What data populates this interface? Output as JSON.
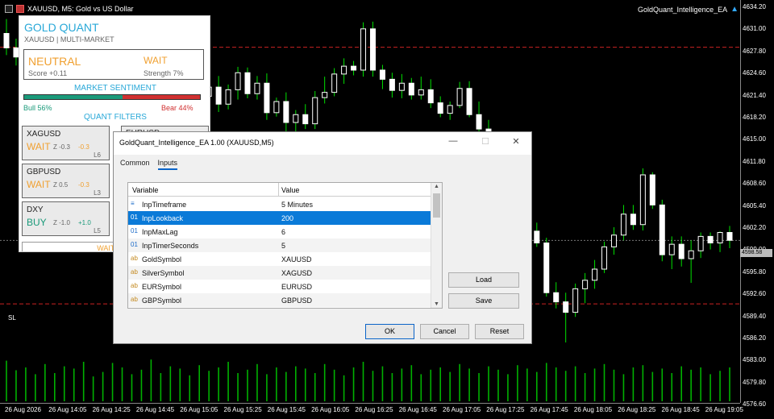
{
  "chart": {
    "title": "XAUUSD, M5:  Gold vs US Dollar",
    "ea_name": "GoldQuant_Intelligence_EA",
    "current_price": "4598.58",
    "sl_label": "SL",
    "price_labels": [
      "4634.20",
      "4631.00",
      "4627.80",
      "4624.60",
      "4621.40",
      "4618.20",
      "4615.00",
      "4611.80",
      "4608.60",
      "4605.40",
      "4602.20",
      "4599.00",
      "4595.80",
      "4592.60",
      "4589.40",
      "4586.20",
      "4583.00",
      "4579.80",
      "4576.60"
    ],
    "date_labels": [
      "26 Aug 2026",
      "26 Aug 14:05",
      "26 Aug 14:25",
      "26 Aug 14:45",
      "26 Aug 15:05",
      "26 Aug 15:25",
      "26 Aug 15:45",
      "26 Aug 16:05",
      "26 Aug 16:25",
      "26 Aug 16:45",
      "26 Aug 17:05",
      "26 Aug 17:25",
      "26 Aug 17:45",
      "26 Aug 18:05",
      "26 Aug 18:25",
      "26 Aug 18:45",
      "26 Aug 19:05"
    ],
    "colors": {
      "bull": "#ffffff",
      "wick": "#00e000",
      "volume": "#00b000",
      "level": "#cc2222",
      "background": "#000000"
    },
    "price_range": [
      4576.6,
      4634.2
    ],
    "level_prices": [
      4628.1,
      4598.58,
      4588.9
    ],
    "candles": [
      [
        4630.2,
        4632.4,
        4626.9,
        4628.0
      ],
      [
        4628.0,
        4629.4,
        4625.3,
        4626.6
      ],
      [
        4626.6,
        4628.2,
        4624.6,
        4627.2
      ],
      [
        4627.2,
        4629.0,
        4626.1,
        4626.5
      ],
      [
        4626.5,
        4627.8,
        4623.6,
        4625.0
      ],
      [
        4625.0,
        4627.6,
        4624.2,
        4626.4
      ],
      [
        4626.4,
        4630.4,
        4625.6,
        4628.6
      ],
      [
        4628.6,
        4629.6,
        4624.5,
        4625.4
      ],
      [
        4625.4,
        4628.6,
        4623.4,
        4627.0
      ],
      [
        4627.0,
        4630.8,
        4626.0,
        4629.9
      ],
      [
        4629.9,
        4631.3,
        4627.0,
        4628.6
      ],
      [
        4628.6,
        4630.2,
        4625.9,
        4627.3
      ],
      [
        4627.3,
        4629.5,
        4624.9,
        4626.4
      ],
      [
        4626.4,
        4627.2,
        4622.0,
        4623.2
      ],
      [
        4623.2,
        4625.9,
        4620.8,
        4624.6
      ],
      [
        4624.6,
        4626.8,
        4621.4,
        4622.1
      ],
      [
        4622.1,
        4623.5,
        4619.0,
        4620.4
      ],
      [
        4620.4,
        4624.0,
        4619.4,
        4623.2
      ],
      [
        4623.2,
        4625.3,
        4620.8,
        4621.5
      ],
      [
        4621.5,
        4622.8,
        4617.4,
        4618.6
      ],
      [
        4618.6,
        4621.8,
        4617.2,
        4620.6
      ],
      [
        4620.6,
        4623.5,
        4619.2,
        4622.0
      ],
      [
        4622.0,
        4623.7,
        4618.2,
        4619.4
      ],
      [
        4619.4,
        4622.4,
        4618.6,
        4621.6
      ],
      [
        4621.6,
        4625.1,
        4620.1,
        4624.2
      ],
      [
        4624.2,
        4625.0,
        4620.3,
        4621.0
      ],
      [
        4621.0,
        4623.7,
        4620.1,
        4622.6
      ],
      [
        4622.6,
        4624.1,
        4617.0,
        4618.1
      ],
      [
        4618.1,
        4620.4,
        4617.5,
        4619.8
      ],
      [
        4619.8,
        4621.2,
        4615.2,
        4616.6
      ],
      [
        4616.6,
        4618.5,
        4613.3,
        4617.8
      ],
      [
        4617.8,
        4619.4,
        4615.6,
        4616.4
      ],
      [
        4616.4,
        4621.4,
        4615.6,
        4620.4
      ],
      [
        4620.4,
        4623.6,
        4619.5,
        4621.2
      ],
      [
        4621.2,
        4624.9,
        4620.6,
        4624.0
      ],
      [
        4624.0,
        4626.4,
        4622.5,
        4625.2
      ],
      [
        4625.2,
        4626.0,
        4623.8,
        4624.6
      ],
      [
        4624.6,
        4631.9,
        4623.6,
        4630.9
      ],
      [
        4630.9,
        4632.0,
        4623.6,
        4624.6
      ],
      [
        4624.6,
        4625.4,
        4621.7,
        4623.2
      ],
      [
        4623.2,
        4624.2,
        4620.4,
        4621.5
      ],
      [
        4621.5,
        4624.0,
        4620.3,
        4622.6
      ],
      [
        4622.6,
        4623.4,
        4620.1,
        4620.8
      ],
      [
        4620.8,
        4623.6,
        4620.1,
        4621.6
      ],
      [
        4621.6,
        4623.2,
        4618.8,
        4619.6
      ],
      [
        4619.6,
        4620.6,
        4617.4,
        4618.0
      ],
      [
        4618.0,
        4619.8,
        4617.0,
        4619.2
      ],
      [
        4619.2,
        4622.8,
        4618.8,
        4621.8
      ],
      [
        4621.8,
        4622.9,
        4617.4,
        4617.8
      ],
      [
        4617.8,
        4619.8,
        4614.7,
        4615.6
      ],
      [
        4615.6,
        4617.0,
        4611.9,
        4612.6
      ],
      [
        4612.6,
        4614.0,
        4608.4,
        4609.3
      ],
      [
        4609.3,
        4610.6,
        4604.8,
        4607.2
      ],
      [
        4607.2,
        4608.0,
        4601.4,
        4602.3
      ],
      [
        4602.3,
        4603.4,
        4598.8,
        4600.0
      ],
      [
        4600.0,
        4601.3,
        4597.6,
        4598.2
      ],
      [
        4598.2,
        4599.0,
        4590.0,
        4590.6
      ],
      [
        4590.6,
        4592.2,
        4588.2,
        4589.2
      ],
      [
        4589.2,
        4590.6,
        4583.0,
        4587.6
      ],
      [
        4587.6,
        4592.0,
        4586.9,
        4591.2
      ],
      [
        4591.2,
        4593.6,
        4589.0,
        4592.5
      ],
      [
        4592.5,
        4595.6,
        4591.2,
        4594.2
      ],
      [
        4594.2,
        4598.4,
        4593.6,
        4597.6
      ],
      [
        4597.6,
        4600.6,
        4596.4,
        4599.4
      ],
      [
        4599.4,
        4604.0,
        4598.6,
        4602.6
      ],
      [
        4602.6,
        4604.0,
        4600.2,
        4601.0
      ],
      [
        4601.0,
        4609.6,
        4600.1,
        4608.6
      ],
      [
        4608.6,
        4609.0,
        4603.4,
        4604.0
      ],
      [
        4604.0,
        4604.8,
        4595.4,
        4596.4
      ],
      [
        4596.4,
        4599.2,
        4594.2,
        4598.0
      ],
      [
        4598.0,
        4599.2,
        4594.6,
        4595.8
      ],
      [
        4595.8,
        4598.6,
        4592.1,
        4597.0
      ],
      [
        4597.0,
        4599.8,
        4595.9,
        4599.2
      ],
      [
        4599.2,
        4599.8,
        4597.2,
        4598.2
      ],
      [
        4598.2,
        4600.0,
        4596.8,
        4599.8
      ],
      [
        4599.8,
        4600.8,
        4597.4,
        4598.6
      ]
    ],
    "volumes": [
      0.72,
      0.55,
      0.6,
      0.48,
      0.66,
      0.5,
      0.62,
      0.58,
      0.7,
      0.44,
      0.52,
      0.68,
      0.6,
      0.48,
      0.56,
      0.74,
      0.5,
      0.62,
      0.58,
      0.46,
      0.64,
      0.54,
      0.6,
      0.7,
      0.5,
      0.56,
      0.66,
      0.48,
      0.6,
      0.52,
      0.62,
      0.58,
      0.5,
      0.66,
      0.56,
      0.46,
      0.6,
      0.7,
      0.54,
      0.62,
      0.5,
      0.58,
      0.64,
      0.48,
      0.56,
      0.6,
      0.52,
      0.66,
      0.58,
      0.5,
      0.62,
      0.56,
      0.48,
      0.64,
      0.58,
      0.52,
      0.68,
      0.6,
      0.54,
      0.62,
      0.5,
      0.58,
      0.66,
      0.56,
      0.48,
      0.6,
      0.64,
      0.52,
      0.58,
      0.5,
      0.62,
      0.56,
      0.6,
      0.48,
      0.54,
      0.6
    ]
  },
  "panel": {
    "title": "GOLD QUANT",
    "subtitle": "XAUUSD | MULTI-MARKET",
    "signal": {
      "state": "NEUTRAL",
      "action": "WAIT",
      "score": "Score +0.11",
      "strength": "Strength 7%"
    },
    "sentiment_header": "MARKET SENTIMENT",
    "bull_fraction": 0.56,
    "bull_label": "Bull 56%",
    "bear_label": "Bear 44%",
    "filters_header": "QUANT FILTERS",
    "filters": [
      {
        "name": "XAGUSD",
        "state": "WAIT",
        "state_color": "#f0a030",
        "z": "Z -0.3",
        "chg": "-0.3",
        "chg_color": "#f0a030",
        "lag": "L6"
      },
      {
        "name": "GBPUSD",
        "state": "WAIT",
        "state_color": "#f0a030",
        "z": "Z 0.5",
        "chg": "-0.3",
        "chg_color": "#f0a030",
        "lag": "L3"
      },
      {
        "name": "DXY",
        "state": "BUY",
        "state_color": "#1a9a7a",
        "z": "Z -1.0",
        "chg": "+1.0",
        "chg_color": "#1a9a7a",
        "lag": "L5"
      }
    ],
    "filter_right_name": "EURUSD",
    "wait_strip": "WAIT FOR"
  },
  "dialog": {
    "title": "GoldQuant_Intelligence_EA 1.00 (XAUUSD,M5)",
    "tabs": [
      "Common",
      "Inputs"
    ],
    "active_tab": "Inputs",
    "columns": [
      "Variable",
      "Value"
    ],
    "rows": [
      {
        "icon": "≡",
        "icon_name": "enum-icon",
        "name": "InpTimeframe",
        "value": "5 Minutes"
      },
      {
        "icon": "01",
        "icon_name": "int-icon",
        "name": "InpLookback",
        "value": "200",
        "selected": true
      },
      {
        "icon": "01",
        "icon_name": "int-icon",
        "name": "InpMaxLag",
        "value": "6"
      },
      {
        "icon": "01",
        "icon_name": "int-icon",
        "name": "InpTimerSeconds",
        "value": "5"
      },
      {
        "icon": "ab",
        "icon_name": "string-icon",
        "name": "GoldSymbol",
        "value": "XAUUSD"
      },
      {
        "icon": "ab",
        "icon_name": "string-icon",
        "name": "SilverSymbol",
        "value": "XAGUSD"
      },
      {
        "icon": "ab",
        "icon_name": "string-icon",
        "name": "EURSymbol",
        "value": "EURUSD"
      },
      {
        "icon": "ab",
        "icon_name": "string-icon",
        "name": "GBPSymbol",
        "value": "GBPUSD"
      }
    ],
    "load_label": "Load",
    "save_label": "Save",
    "ok_label": "OK",
    "cancel_label": "Cancel",
    "reset_label": "Reset"
  }
}
